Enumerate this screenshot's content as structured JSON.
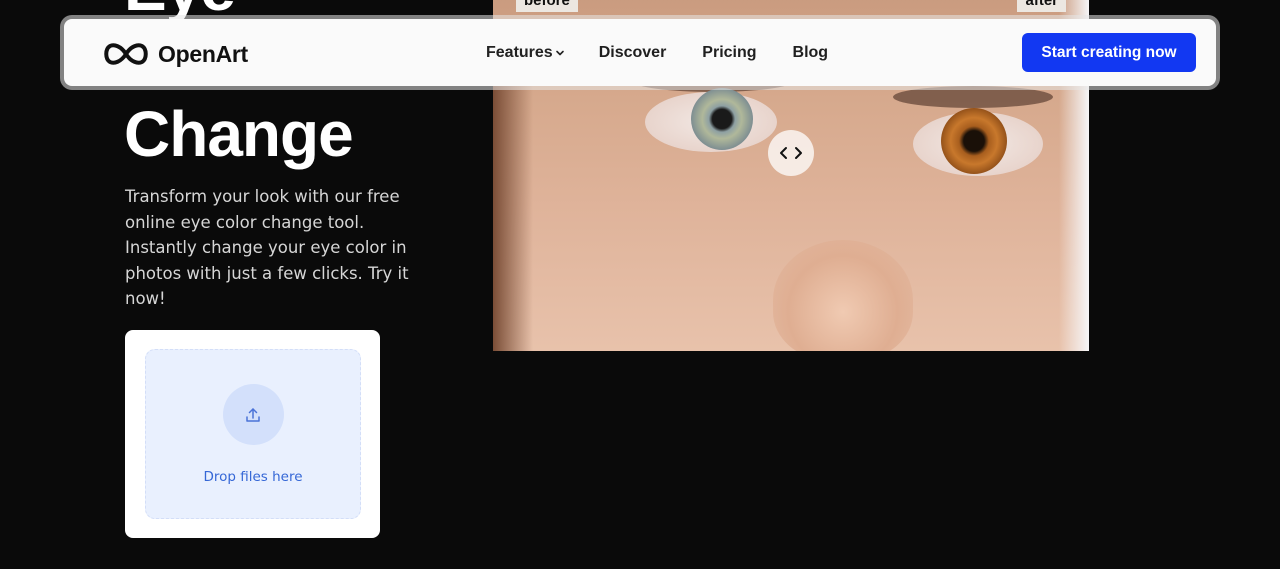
{
  "hero": {
    "title_top": "Eye",
    "title": "Change",
    "description": "Transform your look with our free online eye color change tool. Instantly change your eye color in photos with just a few clicks. Try it now!"
  },
  "upload": {
    "drop_label": "Drop files here",
    "icon": "upload-icon"
  },
  "compare": {
    "before_label": "before",
    "after_label": "after",
    "handle_icon": "chevrons-left-right-icon"
  },
  "navbar": {
    "logo_text": "OpenArt",
    "links": [
      {
        "label": "Features"
      },
      {
        "label": "Discover"
      },
      {
        "label": "Pricing"
      },
      {
        "label": "Blog"
      }
    ],
    "cta_label": "Start creating now"
  },
  "colors": {
    "background": "#0a0a0a",
    "cta": "#1238f2",
    "dropzone": "#e9f0fe",
    "drop_label": "#3567d6"
  }
}
